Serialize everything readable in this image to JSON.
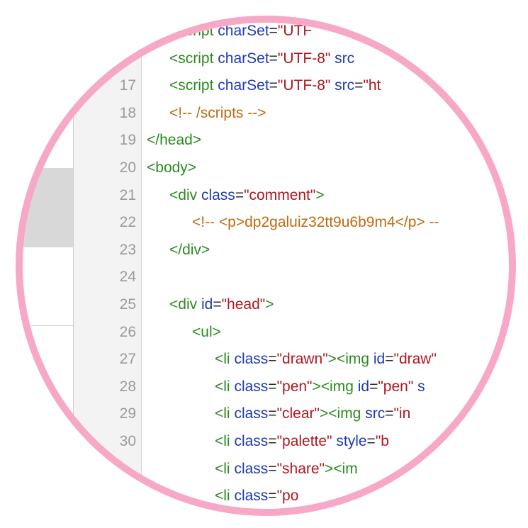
{
  "editor": {
    "lines": [
      {
        "num": "",
        "tokens": [
          {
            "t": "<script ",
            "c": "tag"
          },
          {
            "t": "charSet",
            "c": "attr"
          },
          {
            "t": "=",
            "c": "punct"
          },
          {
            "t": "\"UTF",
            "c": "val"
          }
        ]
      },
      {
        "num": "",
        "tokens": [
          {
            "t": "<script ",
            "c": "tag"
          },
          {
            "t": "charSet",
            "c": "attr"
          },
          {
            "t": "=",
            "c": "punct"
          },
          {
            "t": "\"UTF-8\"",
            "c": "val"
          },
          {
            "t": " src",
            "c": "attr"
          }
        ]
      },
      {
        "num": "17",
        "tokens": [
          {
            "t": "<script ",
            "c": "tag"
          },
          {
            "t": "charSet",
            "c": "attr"
          },
          {
            "t": "=",
            "c": "punct"
          },
          {
            "t": "\"UTF-8\"",
            "c": "val"
          },
          {
            "t": " src",
            "c": "attr"
          },
          {
            "t": "=",
            "c": "punct"
          },
          {
            "t": "\"ht",
            "c": "val"
          }
        ]
      },
      {
        "num": "18",
        "tokens": [
          {
            "t": "<!-- /scripts -->",
            "c": "comm"
          }
        ]
      },
      {
        "num": "19",
        "tokens": [
          {
            "t": "</head>",
            "c": "tag"
          }
        ]
      },
      {
        "num": "20",
        "tokens": [
          {
            "t": "<body>",
            "c": "tag"
          }
        ]
      },
      {
        "num": "21",
        "tokens": [
          {
            "t": "<div ",
            "c": "tag"
          },
          {
            "t": "class",
            "c": "attr"
          },
          {
            "t": "=",
            "c": "punct"
          },
          {
            "t": "\"comment\"",
            "c": "val"
          },
          {
            "t": ">",
            "c": "tag"
          }
        ]
      },
      {
        "num": "22",
        "tokens": [
          {
            "t": "<!-- <p>dp2galuiz32tt9u6b9m4</p> --",
            "c": "comm"
          }
        ]
      },
      {
        "num": "23",
        "tokens": [
          {
            "t": "</div>",
            "c": "tag"
          }
        ]
      },
      {
        "num": "24",
        "tokens": []
      },
      {
        "num": "25",
        "tokens": [
          {
            "t": "<div ",
            "c": "tag"
          },
          {
            "t": "id",
            "c": "attr"
          },
          {
            "t": "=",
            "c": "punct"
          },
          {
            "t": "\"head\"",
            "c": "val"
          },
          {
            "t": ">",
            "c": "tag"
          }
        ]
      },
      {
        "num": "26",
        "tokens": [
          {
            "t": "<ul>",
            "c": "tag"
          }
        ]
      },
      {
        "num": "27",
        "tokens": [
          {
            "t": "<li ",
            "c": "tag"
          },
          {
            "t": "class",
            "c": "attr"
          },
          {
            "t": "=",
            "c": "punct"
          },
          {
            "t": "\"drawn\"",
            "c": "val"
          },
          {
            "t": "><img ",
            "c": "tag"
          },
          {
            "t": "id",
            "c": "attr"
          },
          {
            "t": "=",
            "c": "punct"
          },
          {
            "t": "\"draw\"",
            "c": "val"
          }
        ]
      },
      {
        "num": "28",
        "tokens": [
          {
            "t": "<li ",
            "c": "tag"
          },
          {
            "t": "class",
            "c": "attr"
          },
          {
            "t": "=",
            "c": "punct"
          },
          {
            "t": "\"pen\"",
            "c": "val"
          },
          {
            "t": "><img ",
            "c": "tag"
          },
          {
            "t": "id",
            "c": "attr"
          },
          {
            "t": "=",
            "c": "punct"
          },
          {
            "t": "\"pen\"",
            "c": "val"
          },
          {
            "t": " s",
            "c": "attr"
          }
        ]
      },
      {
        "num": "29",
        "tokens": [
          {
            "t": "<li ",
            "c": "tag"
          },
          {
            "t": "class",
            "c": "attr"
          },
          {
            "t": "=",
            "c": "punct"
          },
          {
            "t": "\"clear\"",
            "c": "val"
          },
          {
            "t": "><img ",
            "c": "tag"
          },
          {
            "t": "src",
            "c": "attr"
          },
          {
            "t": "=",
            "c": "punct"
          },
          {
            "t": "\"in",
            "c": "val"
          }
        ]
      },
      {
        "num": "30",
        "tokens": [
          {
            "t": "<li ",
            "c": "tag"
          },
          {
            "t": "class",
            "c": "attr"
          },
          {
            "t": "=",
            "c": "punct"
          },
          {
            "t": "\"palette\"",
            "c": "val"
          },
          {
            "t": " style",
            "c": "attr"
          },
          {
            "t": "=",
            "c": "punct"
          },
          {
            "t": "\"b",
            "c": "val"
          }
        ]
      },
      {
        "num": "",
        "tokens": [
          {
            "t": "<li ",
            "c": "tag"
          },
          {
            "t": "class",
            "c": "attr"
          },
          {
            "t": "=",
            "c": "punct"
          },
          {
            "t": "\"share\"",
            "c": "val"
          },
          {
            "t": "><im",
            "c": "tag"
          }
        ]
      },
      {
        "num": "",
        "tokens": [
          {
            "t": "<li ",
            "c": "tag"
          },
          {
            "t": "class",
            "c": "attr"
          },
          {
            "t": "=",
            "c": "punct"
          },
          {
            "t": "\"po",
            "c": "val"
          }
        ]
      }
    ]
  },
  "colors": {
    "tag": "#2b8a1f",
    "attr": "#1f3ab5",
    "value": "#b0171f",
    "comment": "#c06a10",
    "ring": "#f7a8c6"
  }
}
